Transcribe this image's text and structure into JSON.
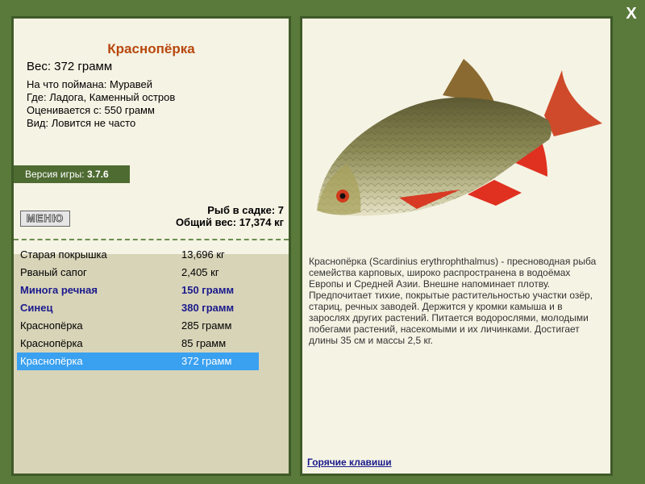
{
  "fish": {
    "name": "Краснопёрка",
    "weight": "Вес: 372 грамм",
    "caught_on": "На что поймана: Муравей",
    "location": "Где: Ладога, Каменный остров",
    "valued_from": "Оценивается с: 550 грамм",
    "rarity": "Вид: Ловится не часто"
  },
  "version": {
    "label": "Версия игры:",
    "value": "3.7.6"
  },
  "menu_label": "МЕНЮ",
  "keepnet": {
    "count_text": "Рыб в садке: 7",
    "total_text": "Общий вес: 17,374 кг"
  },
  "catch_list": [
    {
      "name": "Старая покрышка",
      "weight": "13,696 кг",
      "style": "normal"
    },
    {
      "name": "Рваный сапог",
      "weight": "2,405 кг",
      "style": "normal"
    },
    {
      "name": "Минога речная",
      "weight": "150 грамм",
      "style": "special"
    },
    {
      "name": "Синец",
      "weight": "380 грамм",
      "style": "special"
    },
    {
      "name": "Краснопёрка",
      "weight": "285 грамм",
      "style": "normal"
    },
    {
      "name": "Краснопёрка",
      "weight": "85 грамм",
      "style": "normal"
    },
    {
      "name": "Краснопёрка",
      "weight": "372 грамм",
      "style": "selected"
    }
  ],
  "description": "Краснопёрка (Scardinius erythrophthalmus) - пресноводная рыба семейства карповых, широко распространена в водоёмах Европы и Средней Азии. Внешне напоминает плотву. Предпочитает тихие, покрытые растительностью участки озёр, стариц, речных заводей. Держится у кромки камыша и в зарослях других растений. Питается водорослями, молодыми побегами растений, насекомыми и их личинками. Достигает длины 35 см и массы 2,5 кг.",
  "hotkeys_link": "Горячие клавиши",
  "close_symbol": "X",
  "colors": {
    "panel_bg": "#f5f3e4",
    "frame_green": "#5a7a3c",
    "title_orange": "#b8480e",
    "selected_blue": "#3aa0f0",
    "special_blue": "#1a1a8c"
  }
}
